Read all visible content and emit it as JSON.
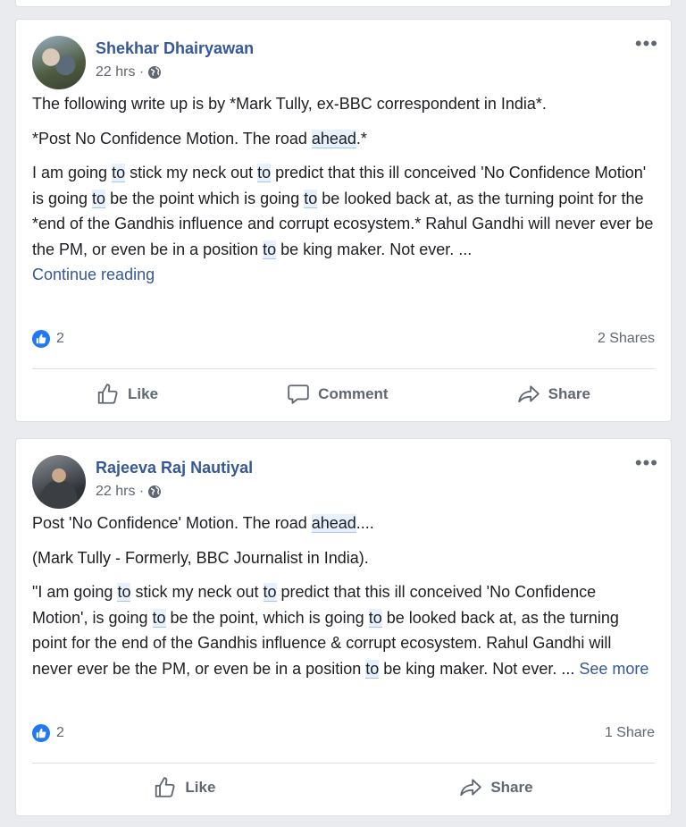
{
  "posts": [
    {
      "author": "Shekhar Dhairyawan",
      "time": "22 hrs ·",
      "privacy_icon": "globe-icon",
      "paragraphs": [
        [
          "The following write up is by *Mark Tully, ex-BBC correspondent in India*."
        ],
        [
          "*Post No Confidence Motion. The road ",
          "ahead",
          ".*"
        ],
        [
          "I am going ",
          "to",
          " stick my neck out ",
          "to",
          " predict that this ill conceived 'No Confidence Motion' is going ",
          "to",
          " be the point which is going ",
          "to",
          " be looked back at, as the turning point for the *end of the Gandhis influence and corrupt ecosystem.* Rahul Gandhi will never ever be the PM, or even be in a position ",
          "to",
          " be king maker. Not ever. ..."
        ]
      ],
      "continue_label": "Continue reading",
      "reaction_count": "2",
      "shares": "2 Shares",
      "actions": {
        "like": "Like",
        "comment": "Comment",
        "share": "Share"
      }
    },
    {
      "author": "Rajeeva Raj Nautiyal",
      "time": "22 hrs ·",
      "privacy_icon": "globe-icon",
      "paragraphs": [
        [
          "Post 'No Confidence' Motion. The road ",
          "ahead",
          "...."
        ],
        [
          "(Mark Tully - Formerly, BBC Journalist in India)."
        ],
        [
          "\"I am going ",
          "to",
          " stick my neck out ",
          "to",
          " predict that this ill conceived 'No Confidence Motion', is going ",
          "to",
          " be the point, which is going ",
          "to",
          " be looked back at, as the turning point for the end of the Gandhis influence & corrupt ecosystem. Rahul Gandhi will never ever be the PM, or even be in a position ",
          "to",
          " be king maker. Not ever. ... "
        ]
      ],
      "see_more_label": "See more",
      "reaction_count": "2",
      "shares": "1 Share",
      "actions": {
        "like": "Like",
        "share": "Share"
      }
    }
  ],
  "more_icon": "•••",
  "colors": {
    "link": "#365899",
    "like_blue": "#2078f4",
    "highlight": "#e7f0fd"
  }
}
